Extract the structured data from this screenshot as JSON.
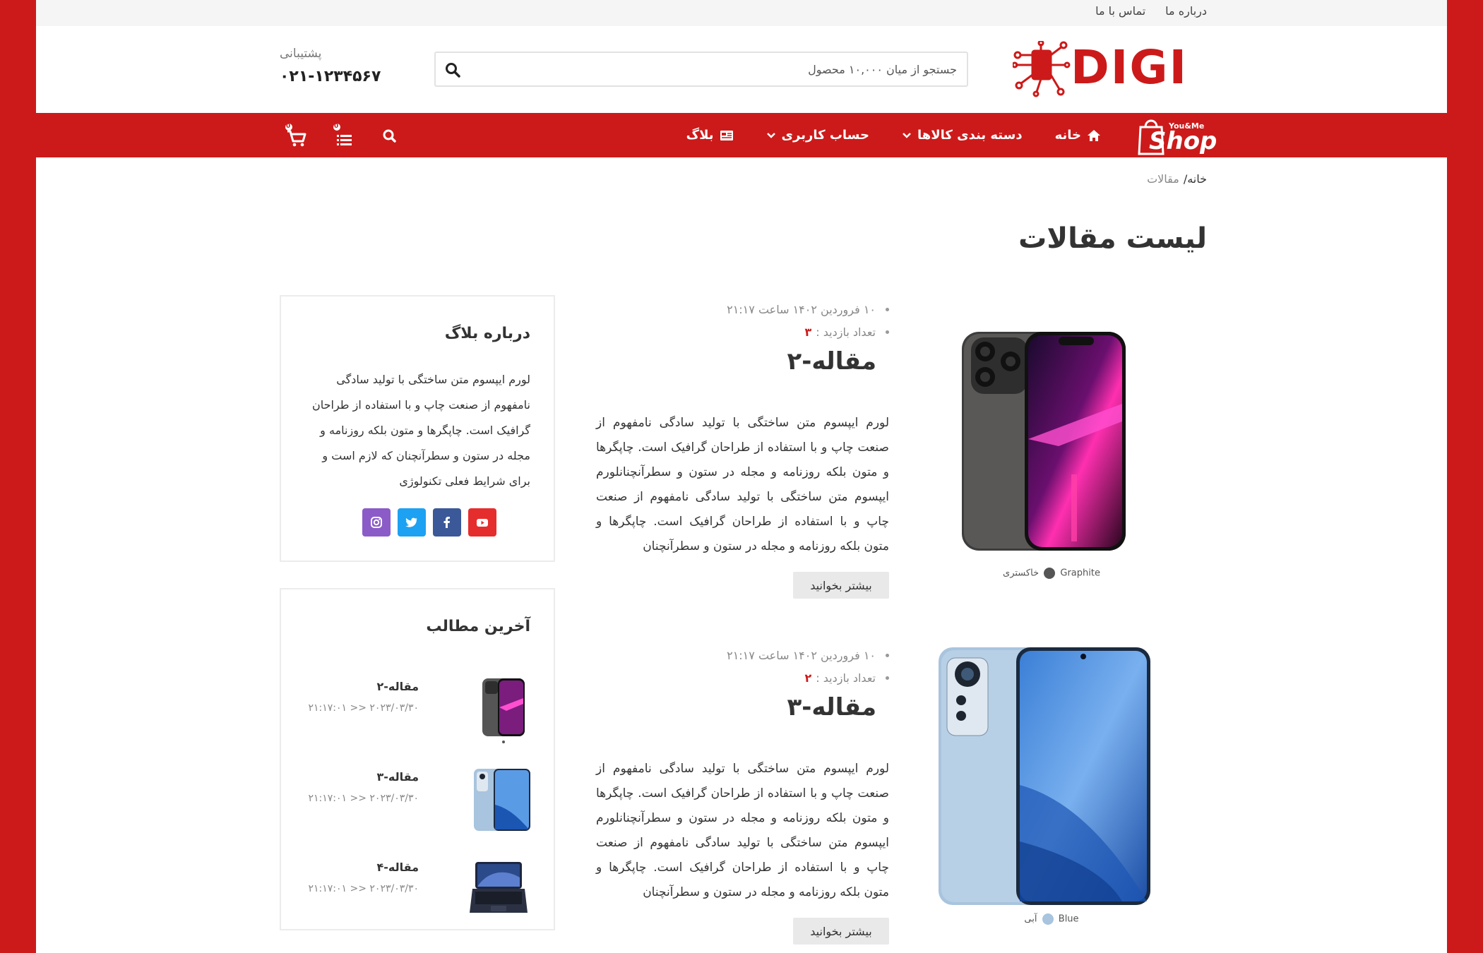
{
  "topbar": {
    "links": [
      "درباره ما",
      "تماس با ما"
    ]
  },
  "header": {
    "logo_text": "DIGI",
    "search_placeholder": "جستجو از میان ۱۰,۰۰۰ محصول",
    "support_label": "پشتیبانی",
    "support_phone": "۰۲۱-۱۲۳۴۵۶۷"
  },
  "navbar": {
    "shop_logo_small": "You&Me",
    "shop_logo_main": "Shop",
    "items": [
      {
        "label": "خانه",
        "icon": "home-icon"
      },
      {
        "label": "دسته بندی کالاها",
        "icon": "chevron-down-icon"
      },
      {
        "label": "حساب کاربری",
        "icon": "chevron-down-icon"
      },
      {
        "label": "بلاگ",
        "icon": "newspaper-icon"
      }
    ],
    "cart_count": "0",
    "compare_count": "0"
  },
  "breadcrumb": {
    "home": "خانه/",
    "current": "مقالات"
  },
  "page_title": "لیست مقالات",
  "articles": [
    {
      "date": "۱۰ فروردین ۱۴۰۲ ساعت ۲۱:۱۷",
      "views_label": "تعداد بازدید :",
      "views": "۳",
      "title": "مقاله-۲",
      "excerpt": "لورم ایپسوم متن ساختگی با تولید سادگی نامفهوم از صنعت چاپ و با استفاده از طراحان گرافیک است. چاپگرها و متون بلکه روزنامه و مجله در ستون و سطرآنچنانلورم ایپسوم متن ساختگی با تولید سادگی نامفهوم از صنعت چاپ و با استفاده از طراحان گرافیک است. چاپگرها و متون بلکه روزنامه و مجله در ستون و سطرآنچنان",
      "more": "بیشتر بخوانید",
      "color_name": "Graphite",
      "color_fa": "خاکستری",
      "color_hex": "#555555"
    },
    {
      "date": "۱۰ فروردین ۱۴۰۲ ساعت ۲۱:۱۷",
      "views_label": "تعداد بازدید :",
      "views": "۲",
      "title": "مقاله-۳",
      "excerpt": "لورم ایپسوم متن ساختگی با تولید سادگی نامفهوم از صنعت چاپ و با استفاده از طراحان گرافیک است. چاپگرها و متون بلکه روزنامه و مجله در ستون و سطرآنچنانلورم ایپسوم متن ساختگی با تولید سادگی نامفهوم از صنعت چاپ و با استفاده از طراحان گرافیک است. چاپگرها و متون بلکه روزنامه و مجله در ستون و سطرآنچنان",
      "more": "بیشتر بخوانید",
      "color_name": "Blue",
      "color_fa": "آبی",
      "color_hex": "#a8c4de"
    }
  ],
  "sidebar": {
    "about_title": "درباره بلاگ",
    "about_text": "لورم ایپسوم متن ساختگی با تولید سادگی نامفهوم از صنعت چاپ و با استفاده از طراحان گرافیک است. چاپگرها و متون بلکه روزنامه و مجله در ستون و سطرآنچنان که لازم است و برای شرایط فعلی تکنولوژی",
    "socials": [
      {
        "icon": "instagram-icon",
        "color": "#8b5cc8"
      },
      {
        "icon": "twitter-icon",
        "color": "#1da1f2"
      },
      {
        "icon": "facebook-icon",
        "color": "#3b5998"
      },
      {
        "icon": "youtube-icon",
        "color": "#e62d2d"
      }
    ],
    "latest_title": "آخرین مطالب",
    "latest": [
      {
        "title": "مقاله-۲",
        "date": "۲۰۲۳/۰۳/۳۰ << ۲۱:۱۷:۰۱"
      },
      {
        "title": "مقاله-۳",
        "date": "۲۰۲۳/۰۳/۳۰ << ۲۱:۱۷:۰۱"
      },
      {
        "title": "مقاله-۴",
        "date": "۲۰۲۳/۰۳/۳۰ << ۲۱:۱۷:۰۱"
      }
    ]
  },
  "colors": {
    "brand_red": "#cc1a1a",
    "text": "#333333"
  }
}
